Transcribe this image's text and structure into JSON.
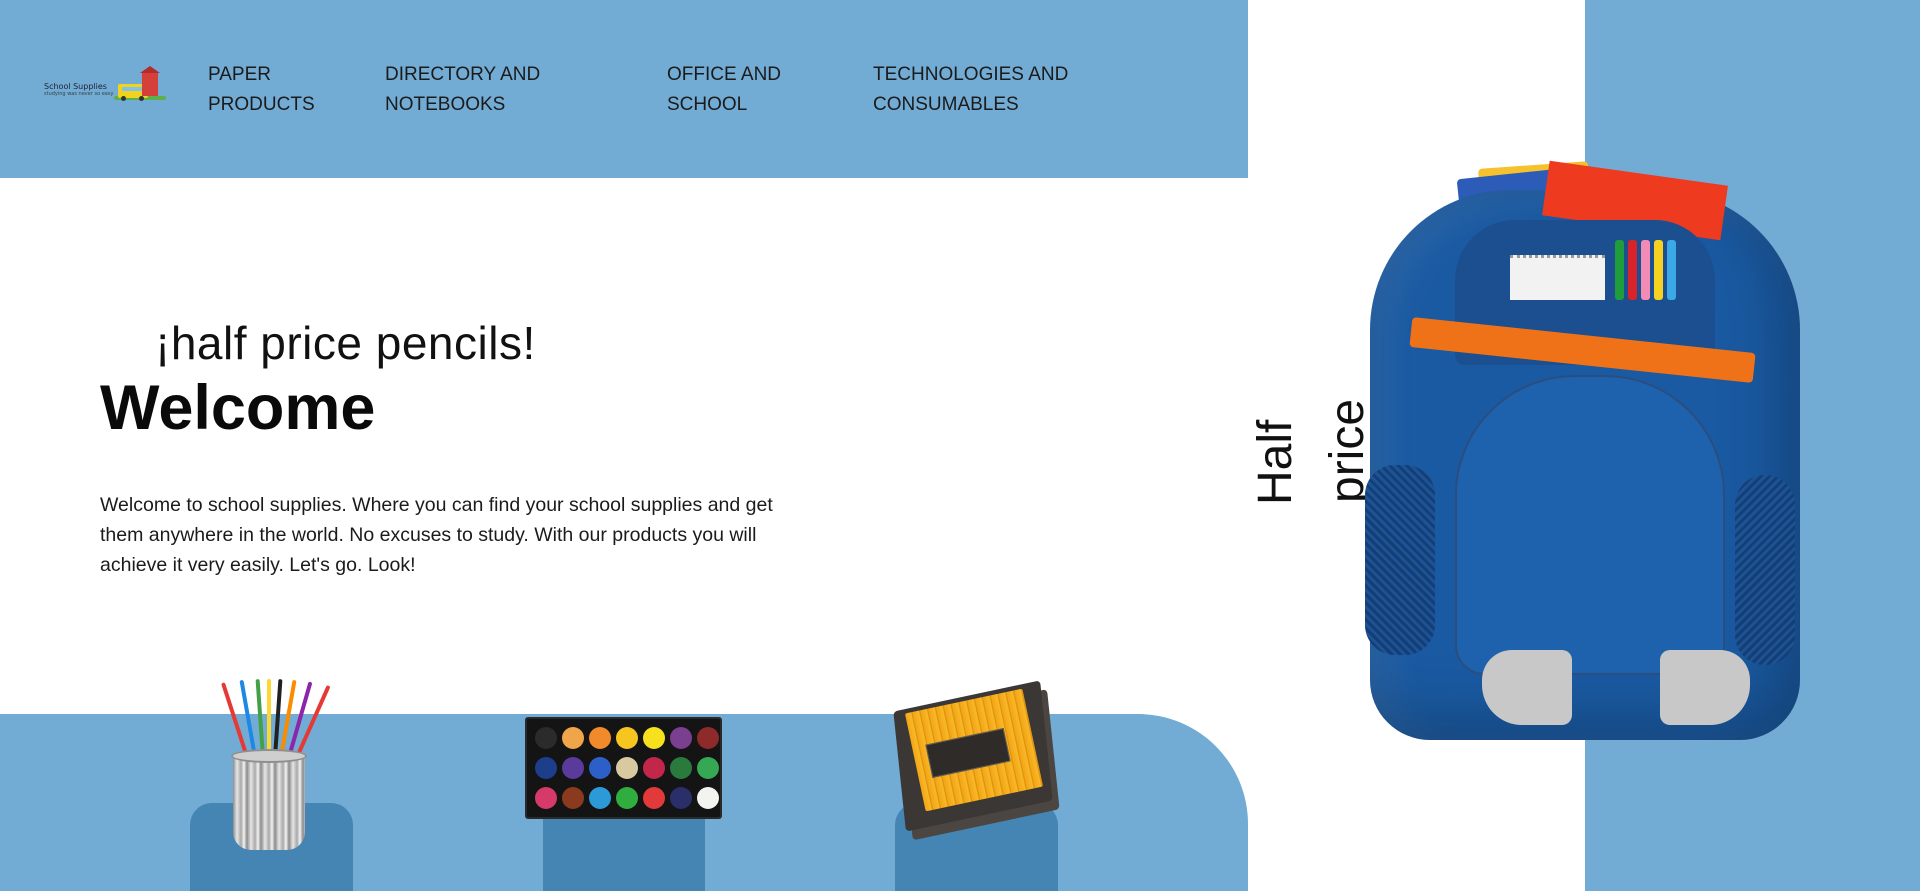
{
  "header": {
    "logo": {
      "title": "School Supplies",
      "subtitle": "studying was never so easy"
    },
    "nav": [
      {
        "label": "PAPER PRODUCTS"
      },
      {
        "label": "DIRECTORY AND NOTEBOOKS"
      },
      {
        "label": "OFFICE AND SCHOOL"
      },
      {
        "label": "TECHNOLOGIES AND CONSUMABLES"
      }
    ]
  },
  "hero": {
    "tagline": "¡half price pencils!",
    "title": "Welcome",
    "intro": "Welcome to school supplies. Where you can find your school supplies and get them anywhere in the world. No excuses to study. With our products you will achieve it very easily. Let's go. Look!"
  },
  "promo": {
    "line1": "Half",
    "line2": "price"
  },
  "colors": {
    "brand_blue": "#72acd5",
    "pedestal_blue": "#4585b3",
    "text": "#111111"
  },
  "products": [
    {
      "icon": "pencil-cup-image"
    },
    {
      "icon": "watercolor-palette-image"
    },
    {
      "icon": "pencil-box-image"
    }
  ],
  "feature_image": "backpack-image"
}
